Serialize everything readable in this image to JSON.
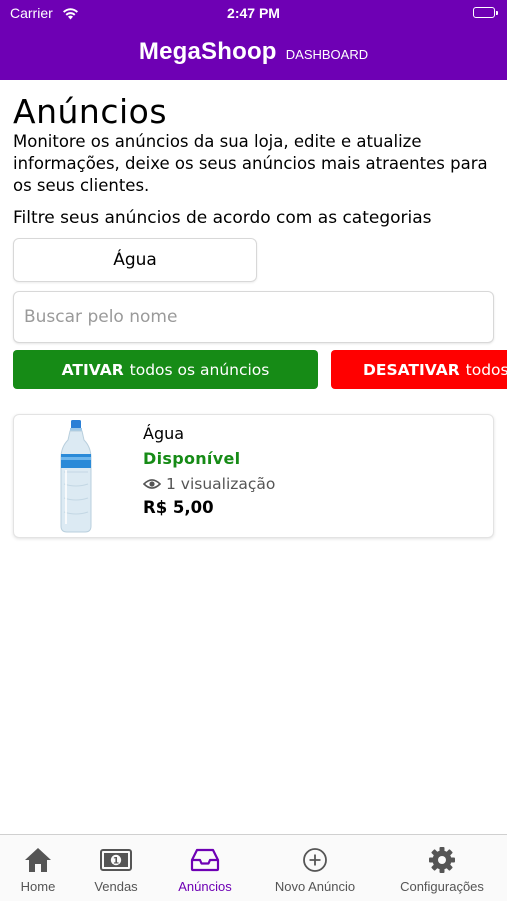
{
  "status_bar": {
    "carrier": "Carrier",
    "time": "2:47 PM"
  },
  "header": {
    "brand": "MegaShoop",
    "sub": "DASHBOARD",
    "color": "#6e00b4"
  },
  "page": {
    "title": "Anúncios",
    "description": "Monitore os anúncios da sua loja, edite e atualize informações, deixe os seus anúncios mais atraentes para os seus clientes.",
    "filter_label": "Filtre seus anúncios de acordo com as categorias",
    "category_selected": "Água",
    "search_placeholder": "Buscar pelo nome"
  },
  "actions": {
    "activate_bold": "ATIVAR",
    "activate_rest": "todos os anúncios",
    "activate_color": "#168b16",
    "deactivate_bold": "DESATIVAR",
    "deactivate_rest": "todos os anúncios",
    "deactivate_color": "#ff0000"
  },
  "products": [
    {
      "name": "Água",
      "status": "Disponível",
      "status_color": "#168b16",
      "views": "1 visualização",
      "price": "R$ 5,00",
      "image": "water-bottle"
    }
  ],
  "tabbar": {
    "items": [
      {
        "label": "Home",
        "icon": "home-icon",
        "active": false
      },
      {
        "label": "Vendas",
        "icon": "money-icon",
        "active": false
      },
      {
        "label": "Anúncios",
        "icon": "inbox-icon",
        "active": true
      },
      {
        "label": "Novo Anúncio",
        "icon": "plus-circle-icon",
        "active": false
      },
      {
        "label": "Configurações",
        "icon": "gear-icon",
        "active": false
      }
    ],
    "active_color": "#6e00b4"
  }
}
